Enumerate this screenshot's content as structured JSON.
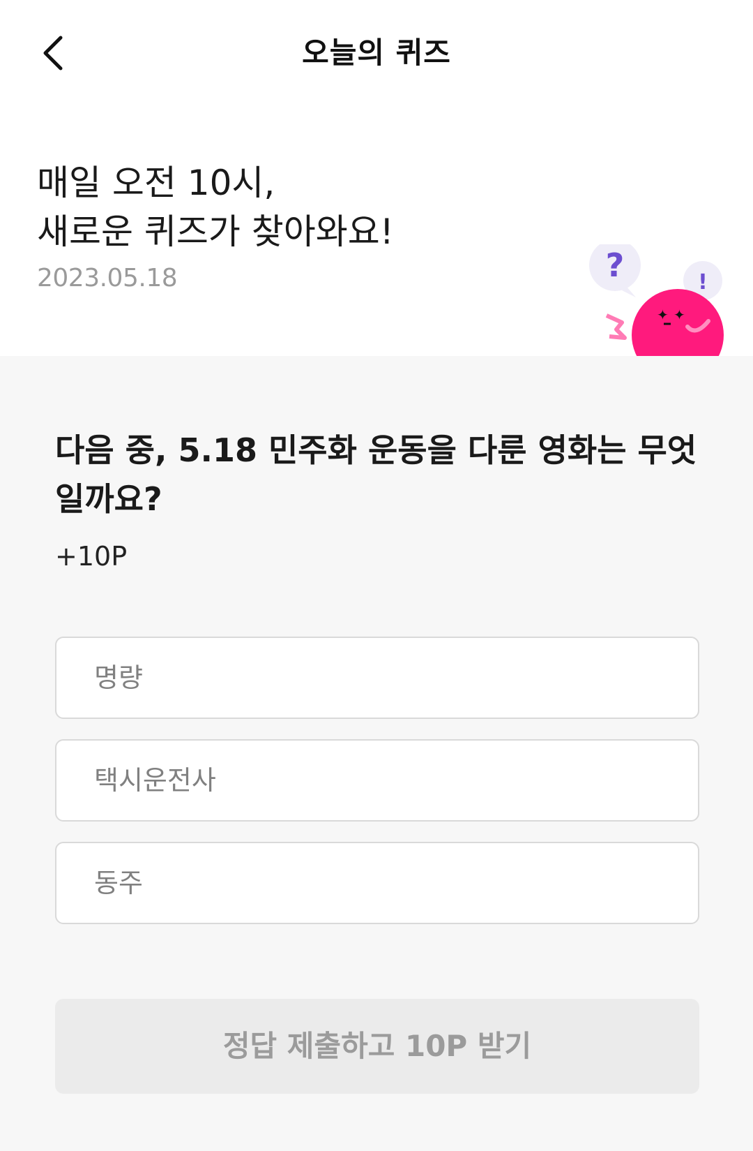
{
  "header": {
    "back_icon": "chevron-left-icon",
    "title": "오늘의 퀴즈"
  },
  "intro": {
    "line1": "매일 오전 10시,",
    "line2": "새로운 퀴즈가 찾아와요!",
    "date": "2023.05.18",
    "mascot_question_mark": "?",
    "mascot_exclaim_mark": "!",
    "colors": {
      "mascot": "#ff1a7d",
      "bubble": "#efedf8",
      "bubble_mark": "#6c4ed0"
    }
  },
  "quiz": {
    "question": "다음 중, 5.18 민주화 운동을 다룬 영화는 무엇일까요?",
    "points": "+10P",
    "options": [
      {
        "label": "명량"
      },
      {
        "label": "택시운전사"
      },
      {
        "label": "동주"
      }
    ],
    "submit_label": "정답 제출하고 10P 받기"
  }
}
